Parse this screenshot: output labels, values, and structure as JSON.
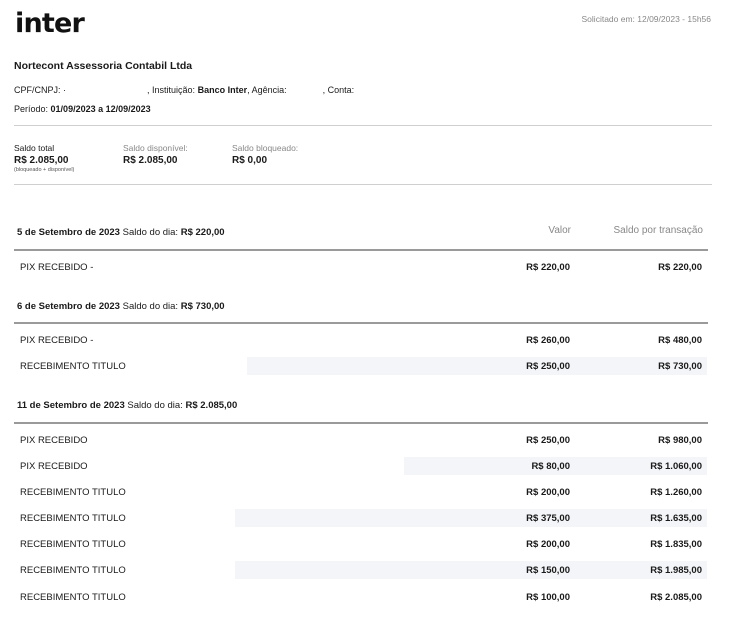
{
  "header": {
    "logo_text": "inter",
    "requested": "Solicitado em: 12/09/2023 - 15h56"
  },
  "account": {
    "company": "Nortecont Assessoria Contabil Ltda",
    "cpf_label": "CPF/CNPJ:",
    "cpf_value": "·",
    "institution_label": ", Instituição:",
    "institution_value": "Banco Inter",
    "agency_label": ", Agência:",
    "account_label": ", Conta:",
    "period_label": "Período:",
    "period_value": "01/09/2023 a 12/09/2023"
  },
  "balances": {
    "total_label": "Saldo total",
    "total_value": "R$ 2.085,00",
    "total_note": "(bloqueado + disponível)",
    "available_label": "Saldo disponível:",
    "available_value": "R$ 2.085,00",
    "blocked_label": "Saldo bloqueado:",
    "blocked_value": "R$ 0,00"
  },
  "columns": {
    "value": "Valor",
    "running": "Saldo por transação"
  },
  "day_label": "Saldo do dia:",
  "days": [
    {
      "date": "5 de Setembro de 2023",
      "balance": "R$ 220,00",
      "rows": [
        {
          "desc": "PIX RECEBIDO -",
          "amount": "R$ 220,00",
          "running": "R$ 220,00"
        }
      ]
    },
    {
      "date": "6 de Setembro de 2023",
      "balance": "R$ 730,00",
      "rows": [
        {
          "desc": "PIX RECEBIDO -",
          "amount": "R$ 260,00",
          "running": "R$ 480,00"
        },
        {
          "desc": "RECEBIMENTO TITULO",
          "amount": "R$ 250,00",
          "running": "R$ 730,00"
        }
      ]
    },
    {
      "date": "11 de Setembro de 2023",
      "balance": "R$ 2.085,00",
      "rows": [
        {
          "desc": "PIX RECEBIDO",
          "amount": "R$ 250,00",
          "running": "R$ 980,00"
        },
        {
          "desc": "PIX RECEBIDO",
          "amount": "R$ 80,00",
          "running": "R$ 1.060,00"
        },
        {
          "desc": "RECEBIMENTO TITULO",
          "amount": "R$ 200,00",
          "running": "R$ 1.260,00"
        },
        {
          "desc": "RECEBIMENTO TITULO",
          "amount": "R$ 375,00",
          "running": "R$ 1.635,00"
        },
        {
          "desc": "RECEBIMENTO TITULO",
          "amount": "R$ 200,00",
          "running": "R$ 1.835,00"
        },
        {
          "desc": "RECEBIMENTO TITULO",
          "amount": "R$ 150,00",
          "running": "R$ 1.985,00"
        },
        {
          "desc": "RECEBIMENTO TITULO",
          "amount": "R$ 100,00",
          "running": "R$ 2.085,00"
        }
      ]
    }
  ]
}
